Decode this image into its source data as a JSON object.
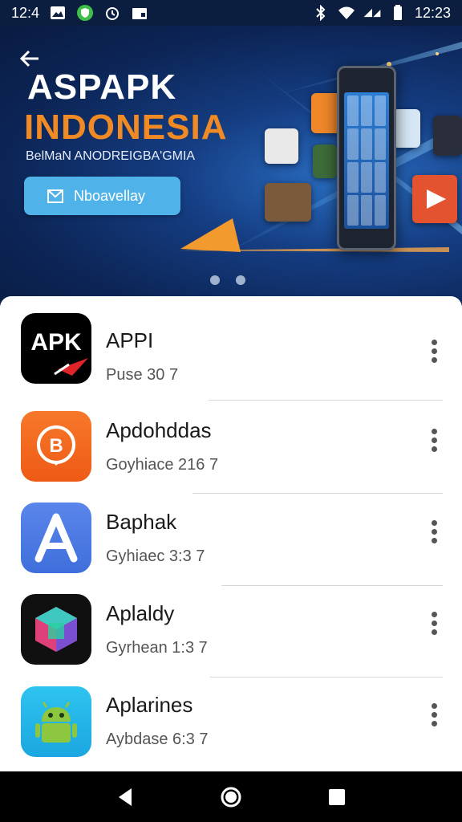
{
  "status_bar": {
    "time_left": "12:4",
    "time_right": "12:23",
    "icons": [
      "image-icon",
      "shield-icon",
      "alarm-icon",
      "store-icon",
      "bluetooth-icon",
      "wifi-icon",
      "signal-icon",
      "battery-icon"
    ]
  },
  "hero": {
    "title_line1": "ASPAPK",
    "title_line2": "INDONESIA",
    "subtitle": "BelMaN ANODREIGBA'GMIA",
    "cta_label": "Nboavellay",
    "colors": {
      "accent": "#f08a24",
      "cta": "#4fb3ea",
      "background": "#0c2556"
    },
    "pages": 2,
    "active_page": 1
  },
  "apps": [
    {
      "name": "APPI",
      "meta": "Puse 30 7",
      "icon": "apk-icon",
      "icon_text": "APK",
      "color": "#000000"
    },
    {
      "name": "Apdohddas",
      "meta": "Goyhiace 216 7",
      "icon": "b-badge-icon",
      "icon_text": "B",
      "color": "#f36a1c"
    },
    {
      "name": "Baphak",
      "meta": "Gyhiaec 3:3 7",
      "icon": "a-letter-icon",
      "icon_text": "A",
      "color": "#4a7be3"
    },
    {
      "name": "Aplaldy",
      "meta": "Gyrhean 1:3 7",
      "icon": "cube-icon",
      "icon_text": "",
      "color": "#111111"
    },
    {
      "name": "Aplarines",
      "meta": "Aybdase 6:3 7",
      "icon": "android-icon",
      "icon_text": "",
      "color": "#1fb5e8"
    }
  ],
  "nav": {
    "icons": [
      "back-icon",
      "home-icon",
      "recents-icon"
    ]
  }
}
